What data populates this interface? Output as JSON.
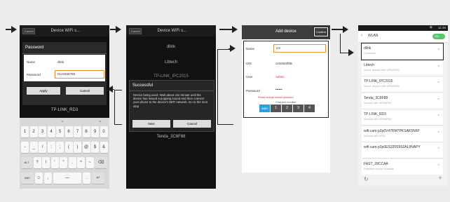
{
  "step1": {
    "cancel_label": "Cancel",
    "title": "Device WiFi s...",
    "dialog_title": "Password",
    "name_label": "Name",
    "name_value": "dlink",
    "password_label": "Password",
    "password_value": "0123456789",
    "apply_label": "Apply",
    "cancel_btn_label": "Cancel",
    "network_below": "TP-LINK_RD3",
    "keyboard_rows": [
      [
        "1",
        "2",
        "3",
        "4",
        "5",
        "6",
        "7",
        "8",
        "9",
        "0"
      ],
      [
        "-",
        "_",
        "/",
        ":",
        ";",
        "(",
        ")",
        "@",
        "$",
        "&"
      ],
      [
        "ALT",
        "?",
        "!",
        "'",
        "\"",
        ".",
        "^",
        "~",
        "⌫"
      ],
      [
        "ABC",
        "☺",
        ",",
        "—",
        ".",
        "↵"
      ]
    ]
  },
  "step2": {
    "cancel_label": "Cancel",
    "title": "Device WiFi s...",
    "networks_above": [
      "dlink",
      "Lbtech",
      "TP-LINK_IPC2015"
    ],
    "dialog_title": "Successful",
    "dialog_message": "Device being used. Wait about one minute until the device has issued a popping sound and then connect your phone to the device's WIFI network. Go to the next step",
    "next_label": "Next",
    "cancel_btn_label": "Cancel",
    "network_below": "Tenda_3C6F88"
  },
  "step3": {
    "title": "Add device",
    "confirm_label": "Confirm",
    "name_label": "Name",
    "name_value": "cm",
    "uid_label": "UID",
    "uid_value": "cc02502f5B",
    "user_label": "User",
    "user_value": "Admin",
    "password_label": "Password",
    "password_value": "••••••",
    "hint": "Please change default password",
    "channel_label": "Channel number",
    "channels": [
      "auto",
      "1",
      "2",
      "3",
      "4"
    ]
  },
  "step4": {
    "status_time": "11:46",
    "back_title": "WLAN",
    "toggle_label": "ON",
    "networks": [
      {
        "name": "dlink",
        "sub": "Connected"
      },
      {
        "name": "Lbtech",
        "sub": "Saved, secured with WPA/WPA2"
      },
      {
        "name": "TP-LINK_IPC2015",
        "sub": "Saved, secured with WPA/WPA2"
      },
      {
        "name": "Tenda_3C6F88",
        "sub": "Secured with WPA/WPA2"
      },
      {
        "name": "TP-LINK_RD3",
        "sub": "Secured with WPA/WPA2"
      },
      {
        "name": "wifi-cam-p2p0V47RM7PKSAK5N6P",
        "sub": "Secured with WPA2"
      },
      {
        "name": "wifi-cam-p2p0ES320S9S0AL9NAPY",
        "sub": ""
      },
      {
        "name": "FAST_28CCAA",
        "sub": "Protected network available"
      }
    ]
  }
}
